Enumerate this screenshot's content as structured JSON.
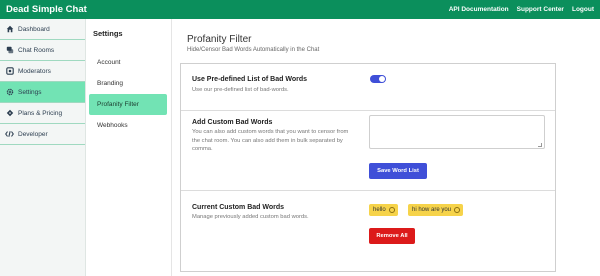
{
  "app": {
    "title": "Dead Simple Chat",
    "nav": [
      "API Documentation",
      "Support Center",
      "Logout"
    ]
  },
  "sidebar": {
    "items": [
      {
        "label": "Dashboard",
        "icon": "home-icon"
      },
      {
        "label": "Chat Rooms",
        "icon": "chat-icon"
      },
      {
        "label": "Moderators",
        "icon": "moderators-icon"
      },
      {
        "label": "Settings",
        "icon": "gear-icon",
        "active": true
      },
      {
        "label": "Plans & Pricing",
        "icon": "plans-icon"
      },
      {
        "label": "Developer",
        "icon": "code-icon"
      }
    ]
  },
  "settings": {
    "title": "Settings",
    "items": [
      {
        "label": "Account"
      },
      {
        "label": "Branding"
      },
      {
        "label": "Profanity Filter",
        "active": true
      },
      {
        "label": "Webhooks"
      }
    ]
  },
  "page": {
    "title": "Profanity Filter",
    "subtitle": "Hide/Censor Bad Words Automatically in the Chat"
  },
  "sections": {
    "predefined": {
      "title": "Use Pre-defined List of Bad Words",
      "desc": "Use our pre-defined list of bad-words.",
      "toggle_on": true
    },
    "custom": {
      "title": "Add Custom Bad Words",
      "desc": "You can also add custom words that you want to censor from the chat room. You can also add them in bulk separated by comma.",
      "textarea_value": "",
      "save_label": "Save Word List"
    },
    "current": {
      "title": "Current Custom Bad Words",
      "desc": "Manage previously added custom bad words.",
      "tags": [
        "hello",
        "hi how are you"
      ],
      "remove_label": "Remove All"
    }
  },
  "colors": {
    "topbar": "#0b8f5c",
    "active": "#72e3b4",
    "primary": "#3f4fd8",
    "danger": "#dc1a1a",
    "tag": "#f6d34a"
  }
}
